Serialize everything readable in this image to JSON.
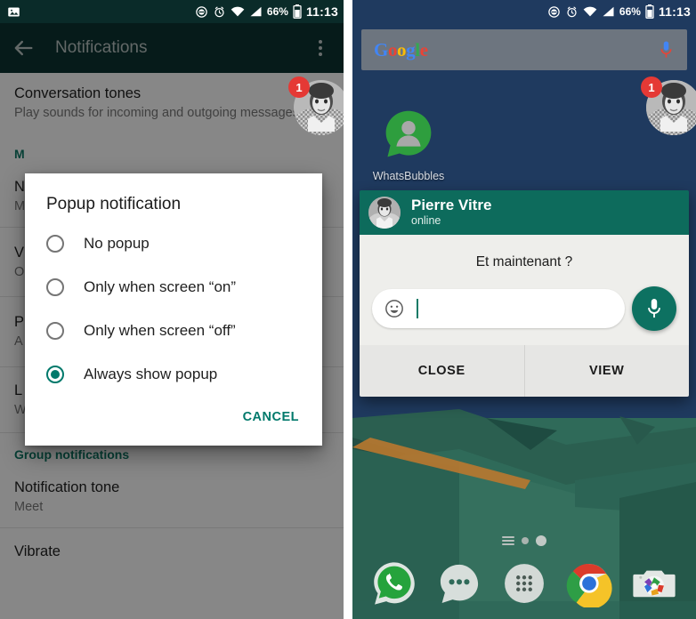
{
  "status_bar": {
    "time": "11:13",
    "battery": "66%",
    "icons": [
      "photo-icon",
      "do-not-disturb-icon",
      "alarm-icon",
      "wifi-icon",
      "signal-icon",
      "battery-icon"
    ]
  },
  "left_screen": {
    "toolbar": {
      "title": "Notifications",
      "back_icon": "back-arrow-icon",
      "overflow_icon": "overflow-menu-icon"
    },
    "rows": [
      {
        "title": "Conversation tones",
        "sub": "Play sounds for incoming and outgoing messages."
      },
      {
        "title": "M",
        "sub": ""
      },
      {
        "title": "N",
        "sub": "M"
      },
      {
        "title": "V",
        "sub": "O"
      },
      {
        "title": "P",
        "sub": "A"
      },
      {
        "title": "L",
        "sub": "W"
      }
    ],
    "section_messages": "M",
    "group_section": "Group notifications",
    "group_rows": [
      {
        "title": "Notification tone",
        "sub": "Meet"
      },
      {
        "title": "Vibrate",
        "sub": ""
      }
    ],
    "chat_head_badge": "1"
  },
  "dialog": {
    "title": "Popup notification",
    "options": [
      {
        "label": "No popup",
        "selected": false
      },
      {
        "label": "Only when screen “on”",
        "selected": false
      },
      {
        "label": "Only when screen “off”",
        "selected": false
      },
      {
        "label": "Always show popup",
        "selected": true
      }
    ],
    "cancel_label": "CANCEL"
  },
  "right_screen": {
    "search": {
      "logo_letters": [
        "G",
        "o",
        "o",
        "g",
        "l",
        "e"
      ],
      "mic_icon": "microphone-icon"
    },
    "home_app": {
      "label": "WhatsBubbles",
      "icon": "whatsbubbles-icon"
    },
    "chat_head_badge": "1",
    "popup": {
      "contact_name": "Pierre Vitre",
      "contact_status": "online",
      "message": "Et maintenant ?",
      "reply_placeholder": "",
      "emoji_icon": "emoji-smiley-icon",
      "mic_icon": "microphone-icon",
      "buttons": [
        {
          "label": "CLOSE"
        },
        {
          "label": "VIEW"
        }
      ]
    },
    "dock": [
      {
        "name": "whatsapp-icon"
      },
      {
        "name": "messages-bubble-icon"
      },
      {
        "name": "app-drawer-icon"
      },
      {
        "name": "chrome-icon"
      },
      {
        "name": "camera-icon"
      }
    ]
  },
  "colors": {
    "toolbar": "#0d3331",
    "status_bar_left": "#0a2b29",
    "status_bar_right": "#1f3a5f",
    "accent_teal": "#00796b",
    "badge_red": "#e53935",
    "popup_header": "#0d6b5c",
    "wallpaper_blue": "#1f3a5f",
    "wallpaper_green": "#2f6a59"
  }
}
